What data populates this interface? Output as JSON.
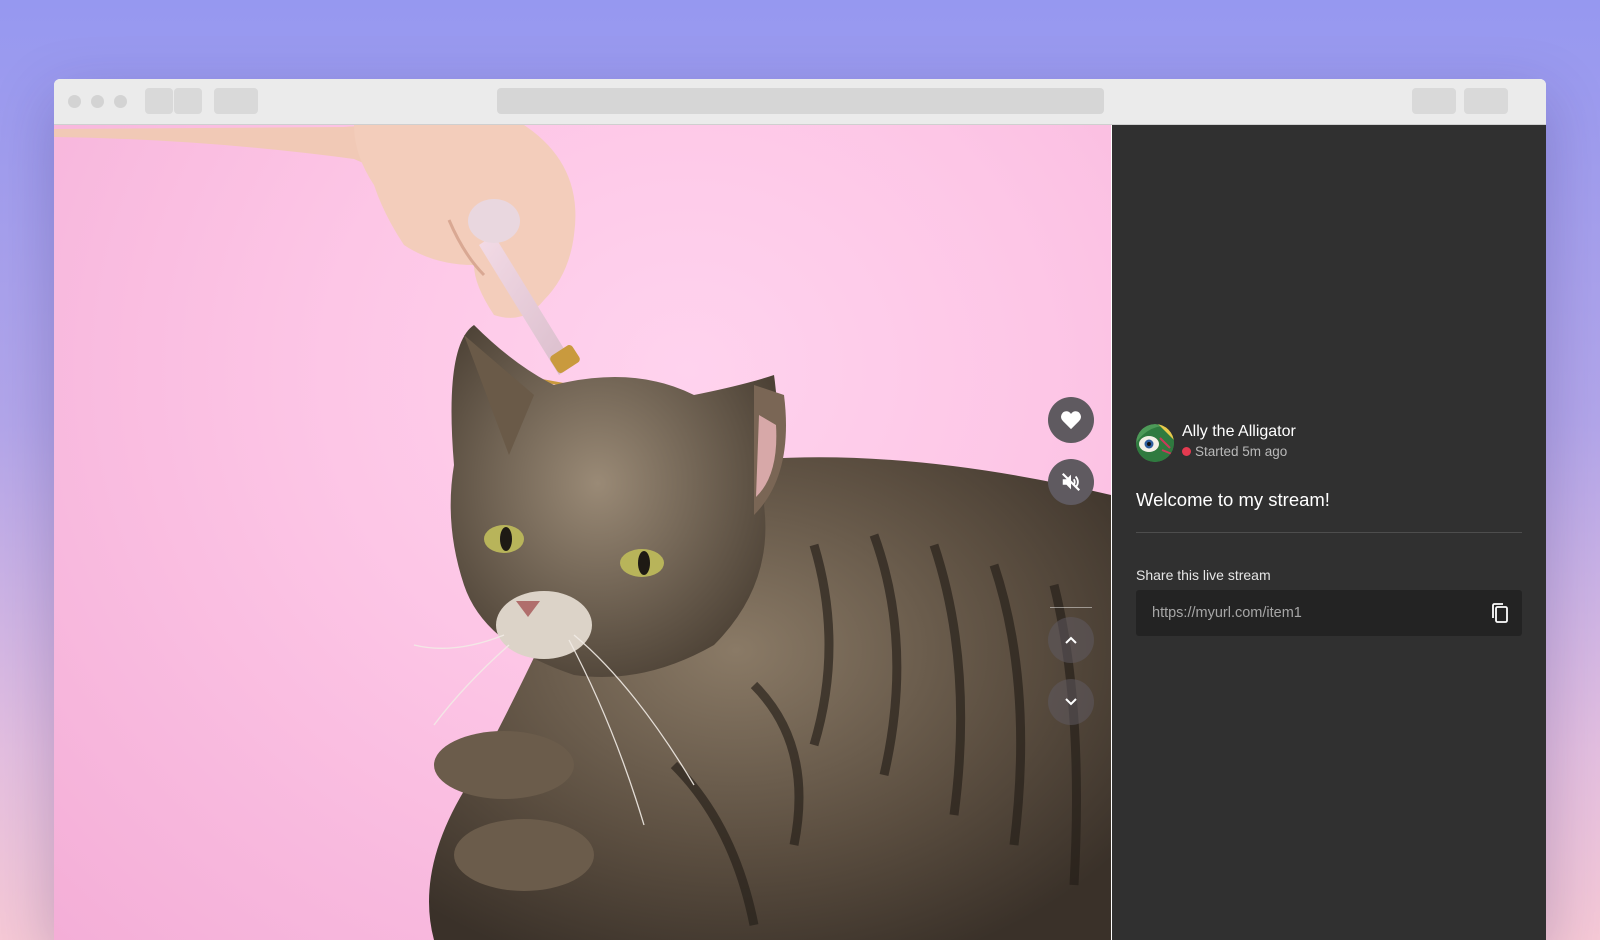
{
  "stream": {
    "streamer_name": "Ally the Alligator",
    "status_text": "Started 5m ago",
    "welcome_message": "Welcome to my stream!"
  },
  "share": {
    "label": "Share this live stream",
    "url": "https://myurl.com/item1"
  },
  "icons": {
    "like": "heart-icon",
    "mute": "speaker-muted-icon",
    "previous": "chevron-up-icon",
    "next": "chevron-down-icon",
    "copy": "copy-icon"
  },
  "colors": {
    "panel_bg": "#303030",
    "live_dot": "#e43a50",
    "video_bg": "#fdc6e6"
  }
}
